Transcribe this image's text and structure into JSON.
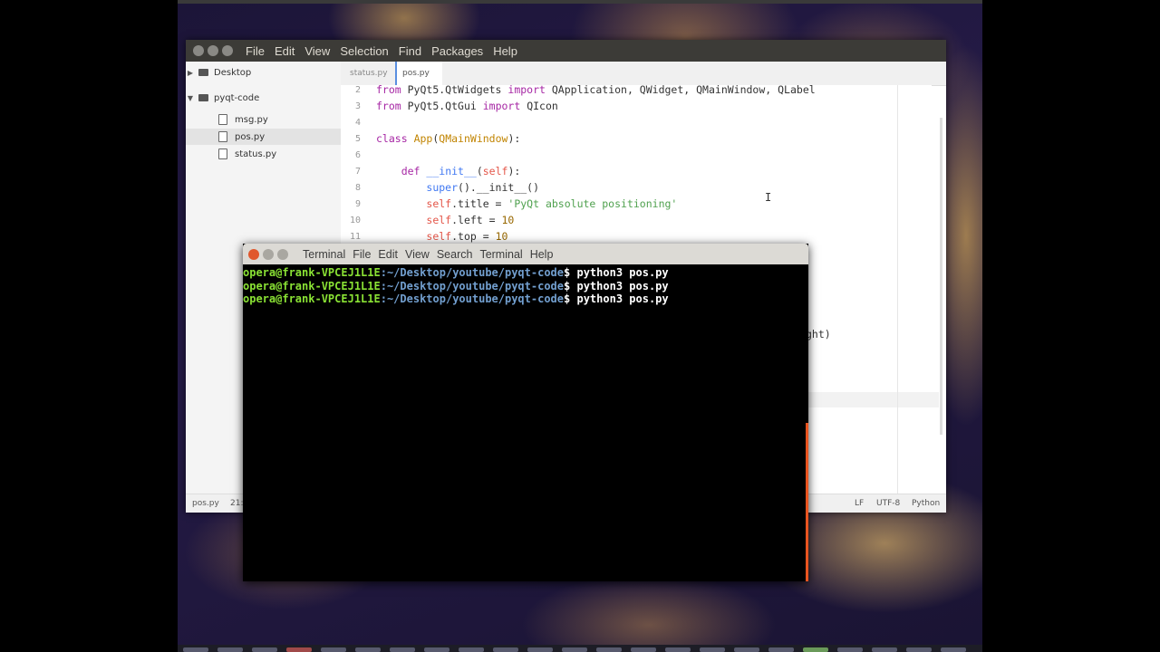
{
  "atom": {
    "menu": [
      "File",
      "Edit",
      "View",
      "Selection",
      "Find",
      "Packages",
      "Help"
    ],
    "tree": [
      {
        "label": "Desktop",
        "type": "folder",
        "arrow": "▶"
      },
      {
        "label": "pyqt-code",
        "type": "folder",
        "arrow": "▼"
      },
      {
        "label": "msg.py",
        "type": "file"
      },
      {
        "label": "pos.py",
        "type": "file",
        "selected": true
      },
      {
        "label": "status.py",
        "type": "file"
      }
    ],
    "tabs": [
      {
        "label": "status.py"
      },
      {
        "label": "pos.py",
        "active": true
      }
    ],
    "line_numbers": [
      "2",
      "3",
      "4",
      "5",
      "6",
      "7",
      "8",
      "9",
      "10",
      "11"
    ],
    "code_right_fragment": "ght)",
    "status": {
      "file": "pos.py",
      "cursor": "21:",
      "eol": "LF",
      "encoding": "UTF-8",
      "grammar": "Python"
    }
  },
  "terminal": {
    "menu": [
      "Terminal",
      "File",
      "Edit",
      "View",
      "Search",
      "Terminal",
      "Help"
    ],
    "prompt_user": "opera@frank-VPCEJ1L1E",
    "prompt_path": ":~/Desktop/youtube/pyqt-code",
    "prompt_symbol": "$",
    "commands": [
      " python3 pos.py",
      " python3 pos.py",
      " python3 pos.py"
    ]
  },
  "colors": {
    "terminal_accent": "#e95420",
    "active_tab": "#5a8fe0"
  }
}
